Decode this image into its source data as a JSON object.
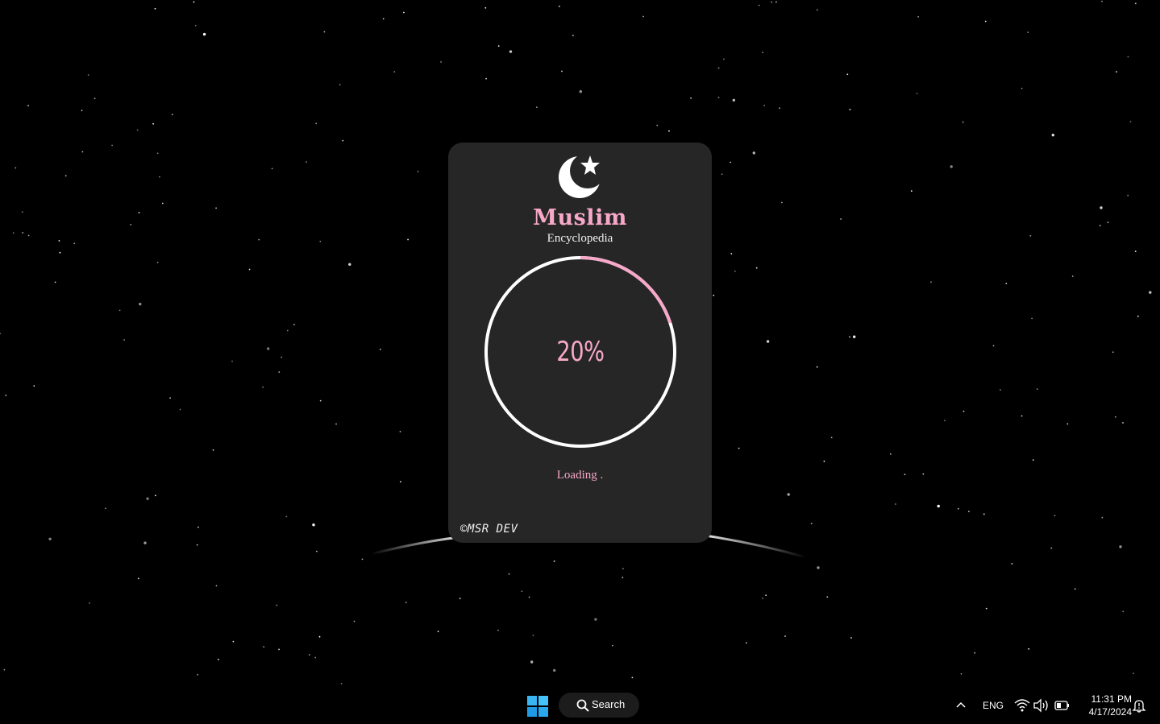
{
  "splash": {
    "logo_icon": "crescent-star-icon",
    "title": "Muslim",
    "subtitle": "Encyclopedia",
    "progress": {
      "value": 0.2,
      "label": "20%",
      "track_color": "#ffffff",
      "fill_color": "#f7a8c8"
    },
    "status": "Loading .",
    "credit": "©MSR DEV",
    "accent_color": "#f7a8c8",
    "card_color": "#262626"
  },
  "taskbar": {
    "start_icon": "windows-logo-icon",
    "search_label": "Search",
    "tray": {
      "language": "ENG",
      "icons": [
        "wifi-icon",
        "volume-icon",
        "battery-icon"
      ],
      "time": "11:31 PM",
      "date": "4/17/2024",
      "notification_icon": "notification-bell-icon"
    }
  }
}
